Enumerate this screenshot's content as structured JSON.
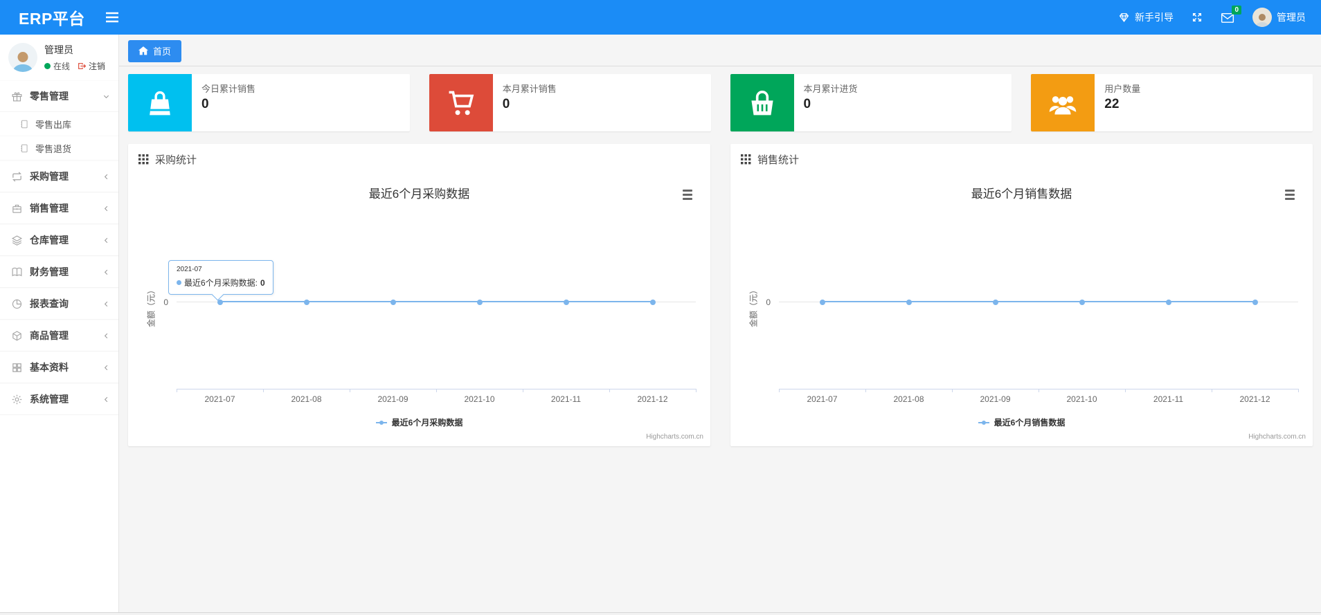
{
  "navbar": {
    "brand": "ERP平台",
    "guide_label": "新手引导",
    "messages_badge": "0",
    "user_name": "管理员"
  },
  "sidebar": {
    "user": {
      "name": "管理员",
      "status": "在线",
      "logout_label": "注销"
    },
    "menu": [
      {
        "label": "零售管理",
        "icon": "gift-icon",
        "state": "expanded",
        "children": [
          {
            "label": "零售出库"
          },
          {
            "label": "零售退货"
          }
        ]
      },
      {
        "label": "采购管理",
        "icon": "repeat-icon"
      },
      {
        "label": "销售管理",
        "icon": "briefcase-icon"
      },
      {
        "label": "仓库管理",
        "icon": "layers-icon"
      },
      {
        "label": "财务管理",
        "icon": "book-icon"
      },
      {
        "label": "报表查询",
        "icon": "pie-chart-icon"
      },
      {
        "label": "商品管理",
        "icon": "box-icon"
      },
      {
        "label": "基本资料",
        "icon": "grid-icon"
      },
      {
        "label": "系统管理",
        "icon": "gear-icon"
      }
    ]
  },
  "tabs": [
    {
      "label": "首页"
    }
  ],
  "stat_cards": [
    {
      "label": "今日累计销售",
      "value": "0",
      "color": "#00c0ef",
      "icon": "shopping-bag-icon"
    },
    {
      "label": "本月累计销售",
      "value": "0",
      "color": "#dd4b39",
      "icon": "cart-icon"
    },
    {
      "label": "本月累计进货",
      "value": "0",
      "color": "#00a65a",
      "icon": "basket-icon"
    },
    {
      "label": "用户数量",
      "value": "22",
      "color": "#f39c12",
      "icon": "users-icon"
    }
  ],
  "panels": [
    {
      "title": "采购统计"
    },
    {
      "title": "销售统计"
    }
  ],
  "chart_data": [
    {
      "type": "line",
      "title": "最近6个月采购数据",
      "categories": [
        "2021-07",
        "2021-08",
        "2021-09",
        "2021-10",
        "2021-11",
        "2021-12"
      ],
      "series": [
        {
          "name": "最近6个月采购数据",
          "values": [
            0,
            0,
            0,
            0,
            0,
            0
          ]
        }
      ],
      "xlabel": "",
      "ylabel": "金额（元）",
      "yticks": [
        "0"
      ],
      "ylim": [
        -1,
        1
      ],
      "grid": true,
      "legend_position": "bottom",
      "color": "#7cb5ec",
      "credits": "Highcharts.com.cn",
      "tooltip": {
        "category": "2021-07",
        "label": "最近6个月采购数据:",
        "value": "0"
      }
    },
    {
      "type": "line",
      "title": "最近6个月销售数据",
      "categories": [
        "2021-07",
        "2021-08",
        "2021-09",
        "2021-10",
        "2021-11",
        "2021-12"
      ],
      "series": [
        {
          "name": "最近6个月销售数据",
          "values": [
            0,
            0,
            0,
            0,
            0,
            0
          ]
        }
      ],
      "xlabel": "",
      "ylabel": "金额（元）",
      "yticks": [
        "0"
      ],
      "ylim": [
        -1,
        1
      ],
      "grid": true,
      "legend_position": "bottom",
      "color": "#7cb5ec",
      "credits": "Highcharts.com.cn"
    }
  ]
}
